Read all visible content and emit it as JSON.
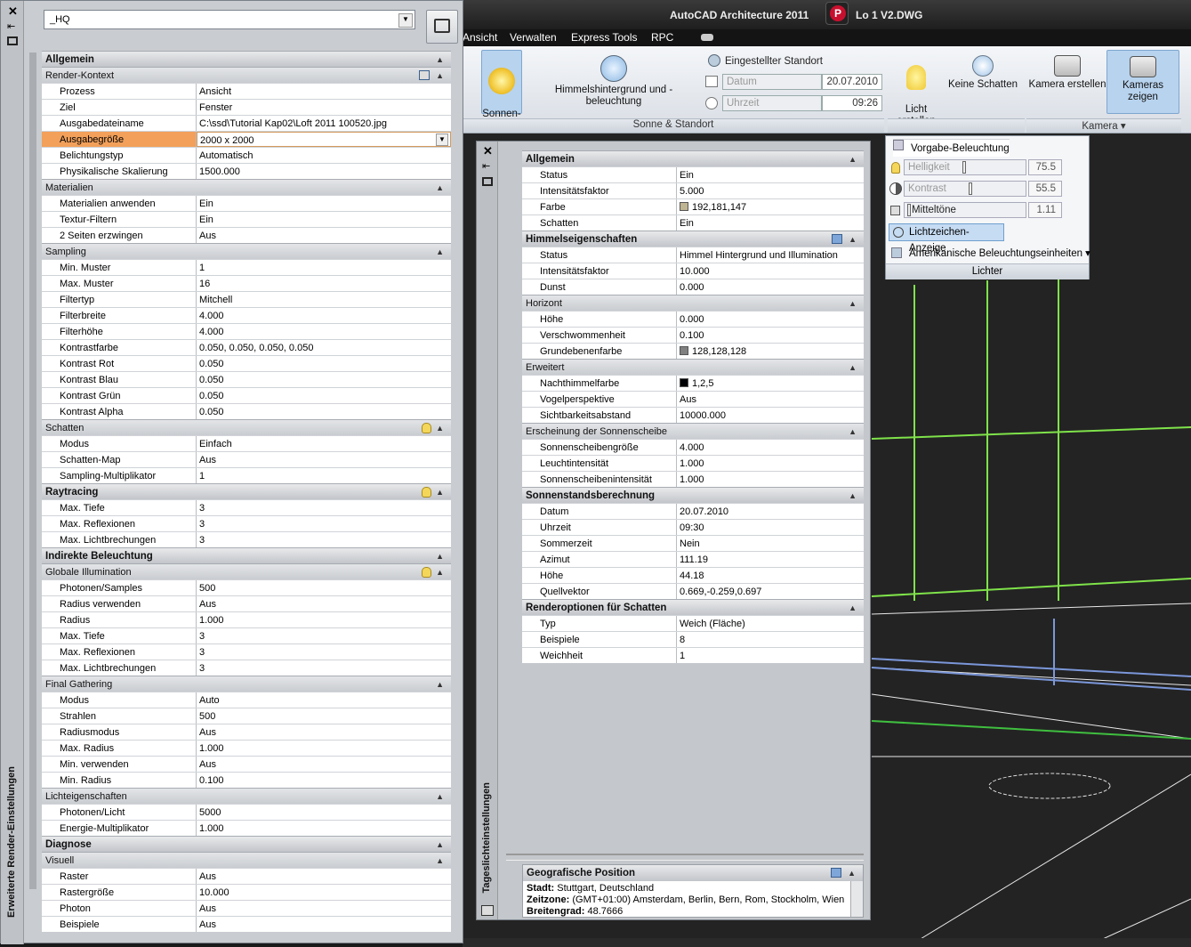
{
  "app": {
    "title": "AutoCAD Architecture 2011",
    "file_suffix": "Lo 1 V2.DWG",
    "logo_letter": "P"
  },
  "menu": {
    "items": [
      "Ansicht",
      "Verwalten",
      "Express Tools",
      "RPC"
    ]
  },
  "ribbon": {
    "sun_button": "Sonnen-\nstand",
    "sky_button": "Himmelshintergrund und -beleuchtung",
    "location": "Eingestellter Standort",
    "date_label": "Datum",
    "date_value": "20.07.2010",
    "time_label": "Uhrzeit",
    "time_value": "09:26",
    "group_sun": "Sonne & Standort",
    "light_create": "Licht\nerstellen",
    "no_shadows": "Keine Schatten",
    "camera_create": "Kamera erstellen",
    "cameras_show": "Kameras zeigen",
    "group_camera": "Kamera"
  },
  "lights_panel": {
    "default_lighting": "Vorgabe-Beleuchtung",
    "brightness": "Helligkeit",
    "brightness_value": "75.5",
    "brightness_level": 0.5,
    "contrast": "Kontrast",
    "contrast_value": "55.5",
    "contrast_level": 0.55,
    "midtones": "Mitteltöne",
    "midtones_value": "1.11",
    "midtones_level": 0.02,
    "glyph_display": "Lichtzeichen-Anzeige",
    "american_units": "Amerikanische Beleuchtungseinheiten",
    "footer": "Lichter"
  },
  "render_panel": {
    "title": "Erweiterte Render-Einstellungen",
    "preset": "_HQ",
    "sections": [
      {
        "name": "Allgemein",
        "major": true,
        "rows": []
      },
      {
        "name": "Render-Kontext",
        "icon": "render",
        "rows": [
          [
            "Prozess",
            "Ansicht"
          ],
          [
            "Ziel",
            "Fenster"
          ],
          [
            "Ausgabedateiname",
            "C:\\ssd\\Tutorial Kap02\\Loft 2011 100520.jpg"
          ],
          [
            "Ausgabegröße",
            "2000 x 2000"
          ],
          [
            "Belichtungstyp",
            "Automatisch"
          ],
          [
            "Physikalische Skalierung",
            "1500.000"
          ]
        ]
      },
      {
        "name": "Materialien",
        "rows": [
          [
            "Materialien anwenden",
            "Ein"
          ],
          [
            "Textur-Filtern",
            "Ein"
          ],
          [
            "2 Seiten erzwingen",
            "Aus"
          ]
        ]
      },
      {
        "name": "Sampling",
        "rows": [
          [
            "Min. Muster",
            "1"
          ],
          [
            "Max. Muster",
            "16"
          ],
          [
            "Filtertyp",
            "Mitchell"
          ],
          [
            "Filterbreite",
            "4.000"
          ],
          [
            "Filterhöhe",
            "4.000"
          ],
          [
            "Kontrastfarbe",
            "0.050, 0.050, 0.050, 0.050"
          ],
          [
            "Kontrast Rot",
            "0.050"
          ],
          [
            "Kontrast Blau",
            "0.050"
          ],
          [
            "Kontrast Grün",
            "0.050"
          ],
          [
            "Kontrast Alpha",
            "0.050"
          ]
        ]
      },
      {
        "name": "Schatten",
        "icon": "bulb",
        "rows": [
          [
            "Modus",
            "Einfach"
          ],
          [
            "Schatten-Map",
            "Aus"
          ],
          [
            "Sampling-Multiplikator",
            "1"
          ]
        ]
      },
      {
        "name": "Raytracing",
        "major": true,
        "icon": "bulb",
        "rows": [
          [
            "Max. Tiefe",
            "3"
          ],
          [
            "Max. Reflexionen",
            "3"
          ],
          [
            "Max. Lichtbrechungen",
            "3"
          ]
        ]
      },
      {
        "name": "Indirekte Beleuchtung",
        "major": true,
        "rows": []
      },
      {
        "name": "Globale Illumination",
        "icon": "bulb",
        "rows": [
          [
            "Photonen/Samples",
            "500"
          ],
          [
            "Radius verwenden",
            "Aus"
          ],
          [
            "Radius",
            "1.000"
          ],
          [
            "Max. Tiefe",
            "3"
          ],
          [
            "Max. Reflexionen",
            "3"
          ],
          [
            "Max. Lichtbrechungen",
            "3"
          ]
        ]
      },
      {
        "name": "Final Gathering",
        "rows": [
          [
            "Modus",
            "Auto"
          ],
          [
            "Strahlen",
            "500"
          ],
          [
            "Radiusmodus",
            "Aus"
          ],
          [
            "Max. Radius",
            "1.000"
          ],
          [
            "Min. verwenden",
            "Aus"
          ],
          [
            "Min. Radius",
            "0.100"
          ]
        ]
      },
      {
        "name": "Lichteigenschaften",
        "rows": [
          [
            "Photonen/Licht",
            "5000"
          ],
          [
            "Energie-Multiplikator",
            "1.000"
          ]
        ]
      },
      {
        "name": "Diagnose",
        "major": true,
        "rows": []
      },
      {
        "name": "Visuell",
        "rows": [
          [
            "Raster",
            "Aus"
          ],
          [
            "Rastergröße",
            "10.000"
          ],
          [
            "Photon",
            "Aus"
          ],
          [
            "Beispiele",
            "Aus"
          ]
        ]
      }
    ]
  },
  "sun_panel": {
    "title": "Tageslichteinstellungen",
    "sections": [
      {
        "name": "Allgemein",
        "major": true,
        "rows": [
          [
            "Status",
            "Ein"
          ],
          [
            "Intensitätsfaktor",
            "5.000"
          ],
          [
            "Farbe",
            "192,181,147"
          ],
          [
            "Schatten",
            "Ein"
          ]
        ]
      },
      {
        "name": "Himmelseigenschaften",
        "major": true,
        "icon": "mon",
        "rows": [
          [
            "Status",
            "Himmel Hintergrund und Illumination"
          ],
          [
            "Intensitätsfaktor",
            "10.000"
          ],
          [
            "Dunst",
            "0.000"
          ]
        ]
      },
      {
        "name": "Horizont",
        "rows": [
          [
            "Höhe",
            "0.000"
          ],
          [
            "Verschwommenheit",
            "0.100"
          ],
          [
            "Grundebenenfarbe",
            "128,128,128"
          ]
        ]
      },
      {
        "name": "Erweitert",
        "rows": [
          [
            "Nachthimmelfarbe",
            "1,2,5"
          ],
          [
            "Vogelperspektive",
            "Aus"
          ],
          [
            "Sichtbarkeitsabstand",
            "10000.000"
          ]
        ]
      },
      {
        "name": "Erscheinung der Sonnenscheibe",
        "rows": [
          [
            "Sonnenscheibengröße",
            "4.000"
          ],
          [
            "Leuchtintensität",
            "1.000"
          ],
          [
            "Sonnenscheibenintensität",
            "1.000"
          ]
        ]
      },
      {
        "name": "Sonnenstandsberechnung",
        "major": true,
        "rows": [
          [
            "Datum",
            "20.07.2010"
          ],
          [
            "Uhrzeit",
            "09:30"
          ],
          [
            "Sommerzeit",
            "Nein"
          ],
          [
            "Azimut",
            "111.19"
          ],
          [
            "Höhe",
            "44.18"
          ],
          [
            "Quellvektor",
            "0.669,-0.259,0.697"
          ]
        ]
      },
      {
        "name": "Renderoptionen für Schatten",
        "major": true,
        "rows": [
          [
            "Typ",
            "Weich (Fläche)"
          ],
          [
            "Beispiele",
            "8"
          ],
          [
            "Weichheit",
            "1"
          ]
        ]
      }
    ],
    "swatches": {
      "Farbe": "#c0b593",
      "Grundebenenfarbe": "#808080",
      "Nachthimmelfarbe": "#010205"
    },
    "geo": {
      "title": "Geografische Position",
      "city_label": "Stadt:",
      "city": "Stuttgart, Deutschland",
      "tz_label": "Zeitzone:",
      "tz": "(GMT+01:00) Amsterdam, Berlin, Bern, Rom, Stockholm, Wien",
      "lat_label": "Breitengrad:",
      "lat": "48.7666"
    }
  },
  "colors": {
    "wire_green": "#7fe34a",
    "panel_bg": "#cfd2d6",
    "highlight": "#f2a05a"
  }
}
